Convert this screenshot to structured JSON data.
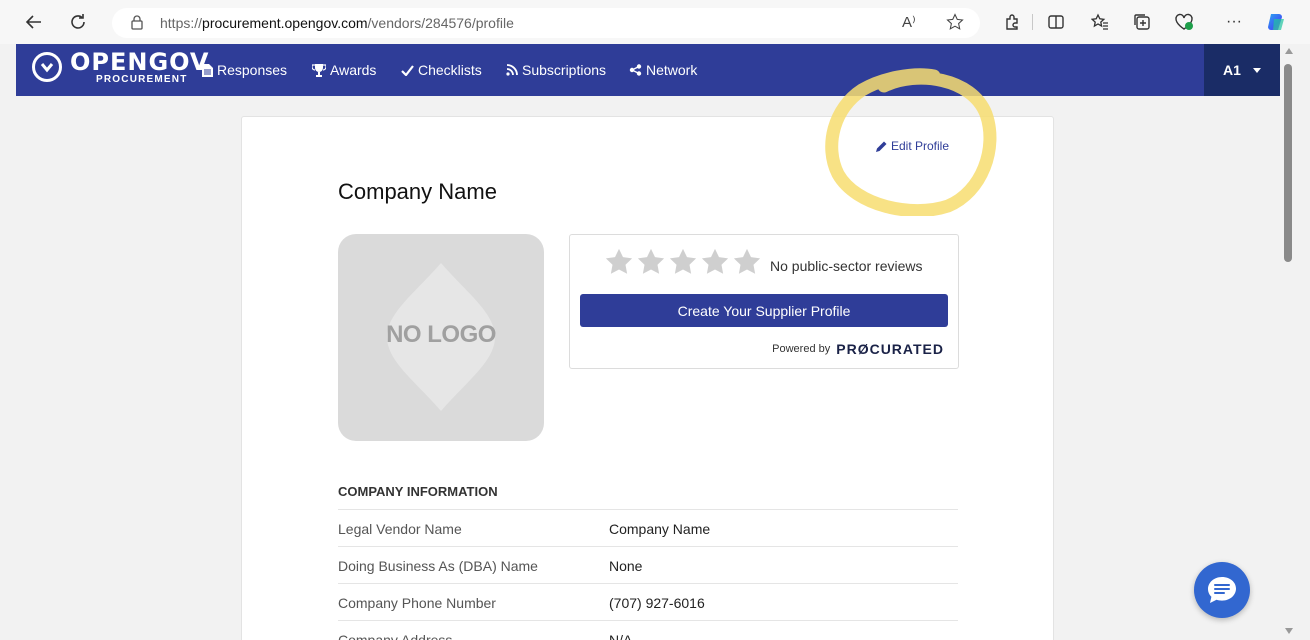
{
  "browser": {
    "url_prefix": "https://",
    "url_host": "procurement.opengov.com",
    "url_path": "/vendors/284576/profile",
    "read_aloud_icon": "A⁾",
    "more_label": "···"
  },
  "nav": {
    "logo_main": "OPENGOV",
    "logo_sub": "PROCUREMENT",
    "items": [
      {
        "label": "Responses",
        "icon": "file-icon"
      },
      {
        "label": "Awards",
        "icon": "trophy-icon"
      },
      {
        "label": "Checklists",
        "icon": "check-icon"
      },
      {
        "label": "Subscriptions",
        "icon": "rss-icon"
      },
      {
        "label": "Network",
        "icon": "share-icon"
      }
    ],
    "user_initials": "A1"
  },
  "profile": {
    "edit_label": "Edit Profile",
    "company_title": "Company Name",
    "no_logo_text": "NO LOGO",
    "rating_stars": 0,
    "reviews_text": "No public-sector reviews",
    "create_button": "Create Your Supplier Profile",
    "powered_by": "Powered by",
    "procurated_brand": "PRØCURATED"
  },
  "company_info": {
    "heading": "COMPANY INFORMATION",
    "rows": [
      {
        "label": "Legal Vendor Name",
        "value": "Company Name"
      },
      {
        "label": "Doing Business As (DBA) Name",
        "value": "None"
      },
      {
        "label": "Company Phone Number",
        "value": "(707) 927-6016"
      },
      {
        "label": "Company Address",
        "value": "N/A"
      }
    ]
  },
  "colors": {
    "nav_bg": "#2f3d98",
    "user_bg": "#1a2c66",
    "highlight": "#f7dd70",
    "chat": "#3267d0"
  }
}
